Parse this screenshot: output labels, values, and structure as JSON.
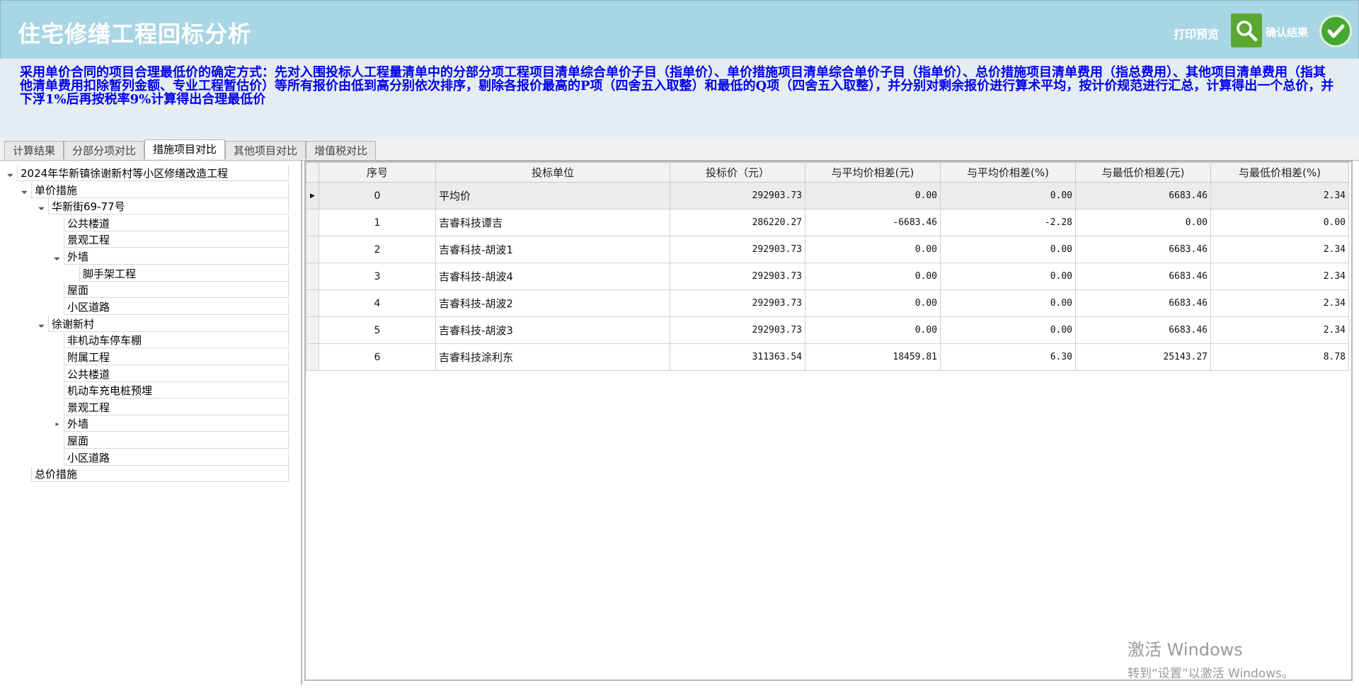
{
  "header": {
    "title": "住宅修缮工程回标分析",
    "print_preview": "打印预览",
    "confirm_result": "确认结果"
  },
  "description": "采用单价合同的项目合理最低价的确定方式：先对入围投标人工程量清单中的分部分项工程项目清单综合单价子目（指单价）、单价措施项目清单综合单价子目（指单价）、总价措施项目清单费用（指总费用）、其他项目清单费用（指其他清单费用扣除暂列金额、专业工程暂估价）等所有报价由低到高分别依次排序，剔除各报价最高的P项（四舍五入取整）和最低的Q项（四舍五入取整），并分别对剩余报价进行算术平均，按计价规范进行汇总，计算得出一个总价，并下浮1%后再按税率9%计算得出合理最低价",
  "tabs": [
    {
      "label": "计算结果",
      "active": false
    },
    {
      "label": "分部分项对比",
      "active": false
    },
    {
      "label": "措施项目对比",
      "active": true
    },
    {
      "label": "其他项目对比",
      "active": false
    },
    {
      "label": "增值税对比",
      "active": false
    }
  ],
  "tree": [
    {
      "label": "2024年华新镇徐谢新村等小区修缮改造工程",
      "toggle": "expanded"
    },
    {
      "label": "单价措施",
      "toggle": "expanded"
    },
    {
      "label": "华新街69-77号",
      "toggle": "expanded"
    },
    {
      "label": "公共楼道",
      "toggle": "none"
    },
    {
      "label": "景观工程",
      "toggle": "none"
    },
    {
      "label": "外墙",
      "toggle": "expanded"
    },
    {
      "label": "脚手架工程",
      "toggle": "none"
    },
    {
      "label": "屋面",
      "toggle": "none"
    },
    {
      "label": "小区道路",
      "toggle": "none"
    },
    {
      "label": "徐谢新村",
      "toggle": "expanded"
    },
    {
      "label": "非机动车停车棚",
      "toggle": "none"
    },
    {
      "label": "附属工程",
      "toggle": "none"
    },
    {
      "label": "公共楼道",
      "toggle": "none"
    },
    {
      "label": "机动车充电桩预埋",
      "toggle": "none"
    },
    {
      "label": "景观工程",
      "toggle": "none"
    },
    {
      "label": "外墙",
      "toggle": "collapsed"
    },
    {
      "label": "屋面",
      "toggle": "none"
    },
    {
      "label": "小区道路",
      "toggle": "none"
    },
    {
      "label": "总价措施",
      "toggle": "none"
    }
  ],
  "grid": {
    "columns": [
      "序号",
      "投标单位",
      "投标价（元）",
      "与平均价相差(元)",
      "与平均价相差(%)",
      "与最低价相差(元)",
      "与最低价相差(%)"
    ],
    "rows": [
      {
        "no": "0",
        "unit": "平均价",
        "price": "292903.73",
        "diff_avg": "0.00",
        "diff_avg_pct": "0.00",
        "diff_min": "6683.46",
        "diff_min_pct": "2.34"
      },
      {
        "no": "1",
        "unit": "吉睿科技谭吉",
        "price": "286220.27",
        "diff_avg": "-6683.46",
        "diff_avg_pct": "-2.28",
        "diff_min": "0.00",
        "diff_min_pct": "0.00"
      },
      {
        "no": "2",
        "unit": "吉睿科技-胡波1",
        "price": "292903.73",
        "diff_avg": "0.00",
        "diff_avg_pct": "0.00",
        "diff_min": "6683.46",
        "diff_min_pct": "2.34"
      },
      {
        "no": "3",
        "unit": "吉睿科技-胡波4",
        "price": "292903.73",
        "diff_avg": "0.00",
        "diff_avg_pct": "0.00",
        "diff_min": "6683.46",
        "diff_min_pct": "2.34"
      },
      {
        "no": "4",
        "unit": "吉睿科技-胡波2",
        "price": "292903.73",
        "diff_avg": "0.00",
        "diff_avg_pct": "0.00",
        "diff_min": "6683.46",
        "diff_min_pct": "2.34"
      },
      {
        "no": "5",
        "unit": "吉睿科技-胡波3",
        "price": "292903.73",
        "diff_avg": "0.00",
        "diff_avg_pct": "0.00",
        "diff_min": "6683.46",
        "diff_min_pct": "2.34"
      },
      {
        "no": "6",
        "unit": "吉睿科技涂利东",
        "price": "311363.54",
        "diff_avg": "18459.81",
        "diff_avg_pct": "6.30",
        "diff_min": "25143.27",
        "diff_min_pct": "8.78"
      }
    ]
  },
  "watermark": {
    "line1": "激活 Windows",
    "line2": "转到“设置”以激活 Windows。"
  },
  "colors": {
    "header_bg": "#a9d6e5",
    "description_text": "#0000ee",
    "accent_green": "#47a831"
  }
}
